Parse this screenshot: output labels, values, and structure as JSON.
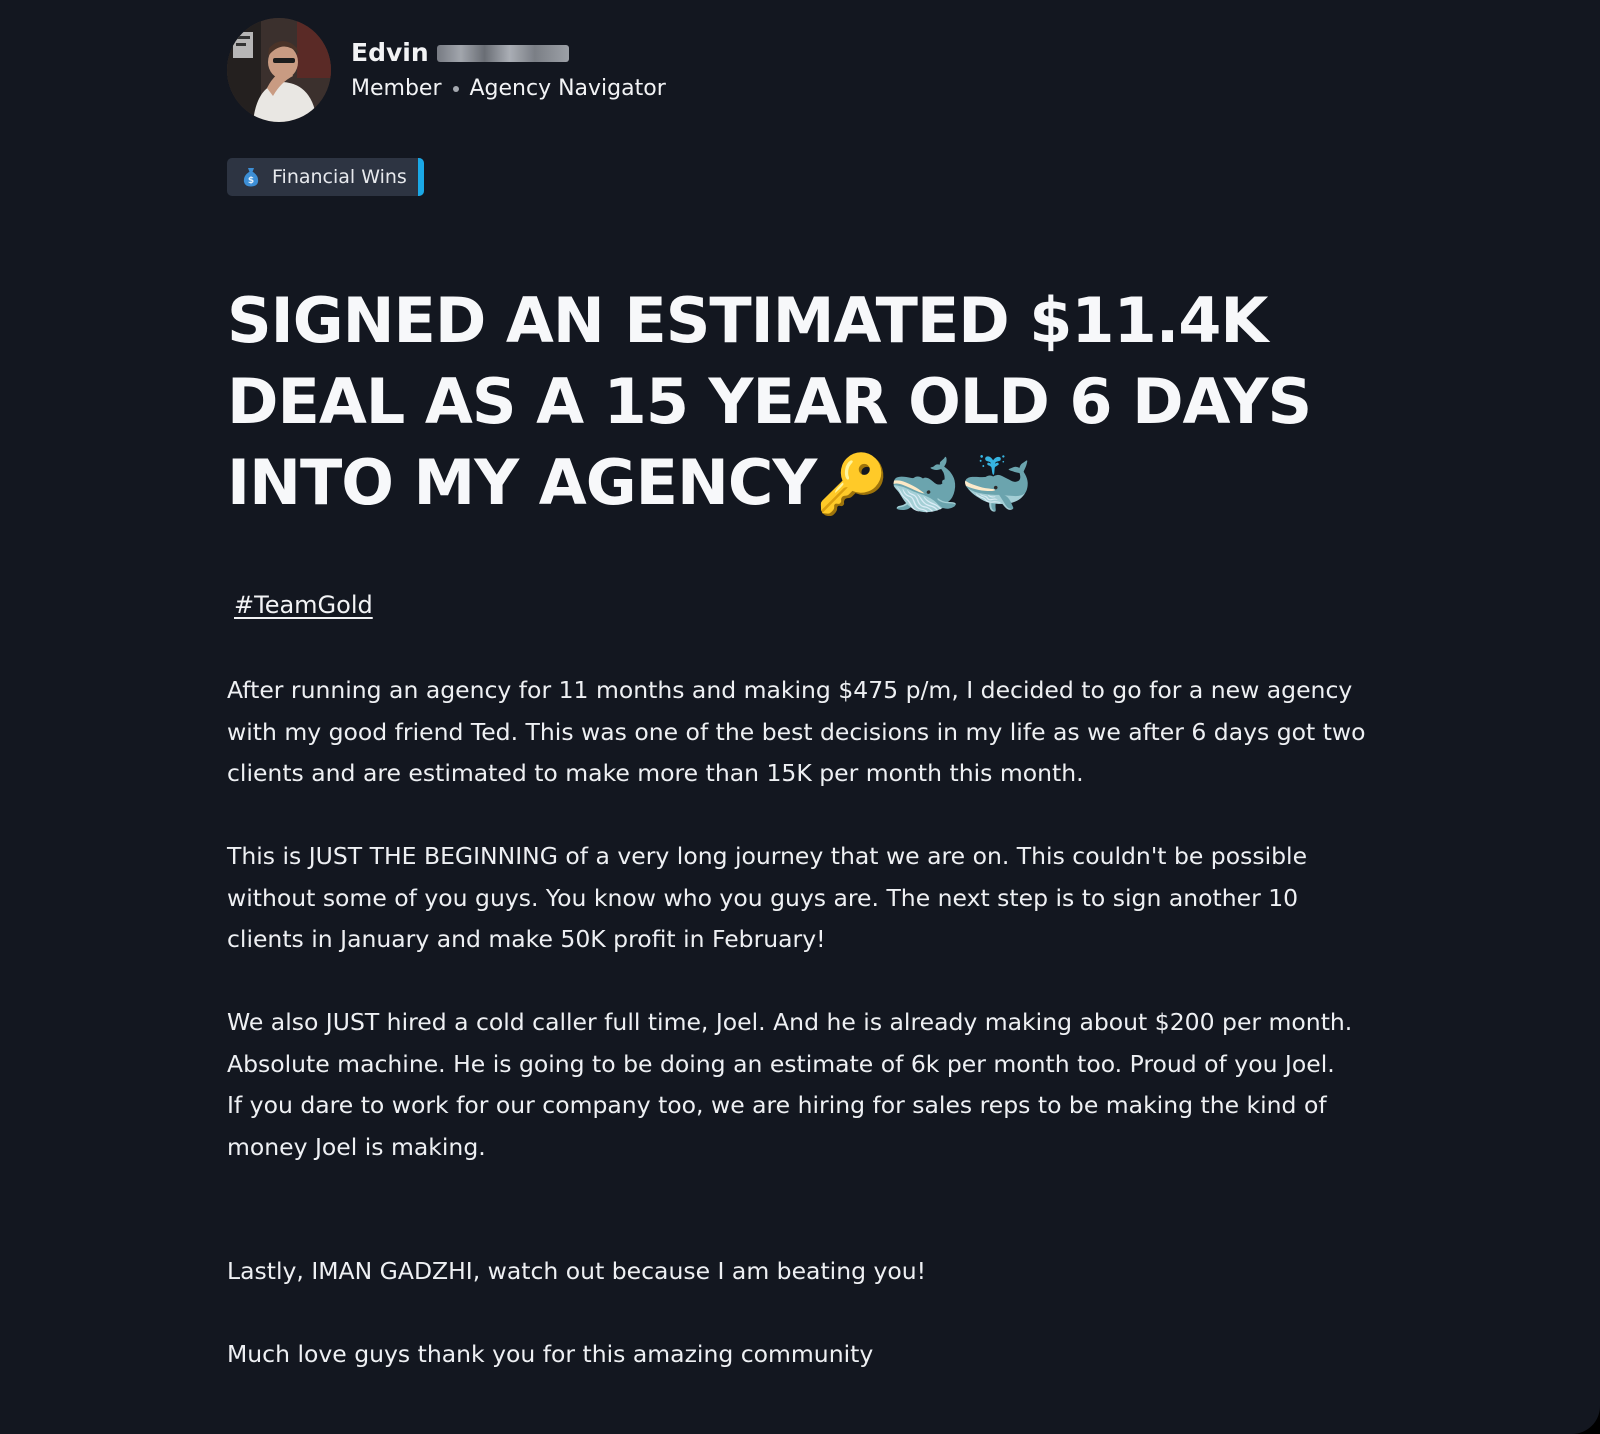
{
  "author": {
    "name": "Edvin",
    "name_redacted": true,
    "role": "Member",
    "group": "Agency Navigator"
  },
  "category": {
    "label": "Financial Wins",
    "icon": "money-bag-icon",
    "accent_color": "#1aa8e6"
  },
  "post": {
    "title": "SIGNED AN ESTIMATED $11.4K DEAL AS A 15 YEAR OLD 6 DAYS INTO MY AGENCY",
    "title_emoji": "🔑🐋🐳",
    "hashtag": "#TeamGold",
    "paragraphs": [
      "After running an agency for 11 months and making $475 p/m, I decided to go for a new agency with my good friend Ted. This was one of the best decisions in my life as we after 6 days got two clients and are estimated to make more than 15K per month this month.",
      "This is JUST THE BEGINNING of a very long journey that we are on. This couldn't be possible without some of you guys. You know who you guys are. The next step is to sign another 10 clients in January and make 50K profit in February!",
      "We also JUST hired a cold caller full time, Joel. And he is already making about $200 per month. Absolute machine. He is going to be doing an estimate of 6k per month too. Proud of you Joel.",
      "If you dare to work for our company too, we are hiring for sales reps to be making the kind of money Joel is making.",
      "Lastly, IMAN GADZHI, watch out because I am beating you!",
      "Much love guys thank you for this amazing community"
    ]
  },
  "colors": {
    "background": "#131720",
    "text": "#eef0f3",
    "tag_background": "#2d3442"
  }
}
